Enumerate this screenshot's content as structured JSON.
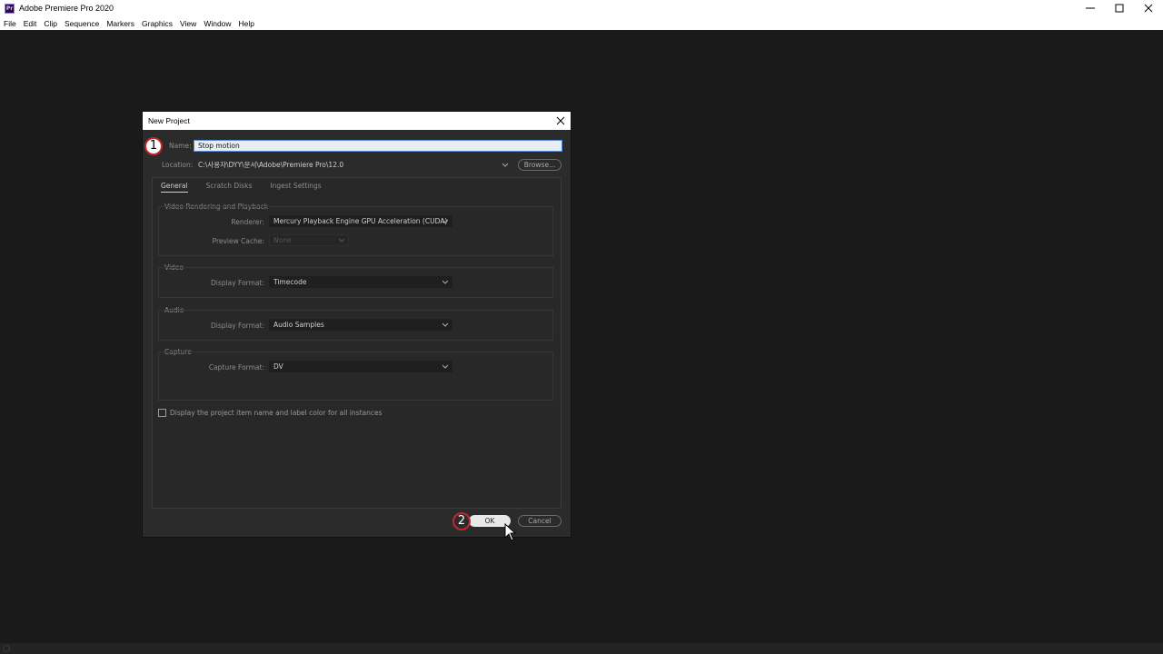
{
  "app": {
    "icon_text": "Pr",
    "title": "Adobe Premiere Pro 2020"
  },
  "menu": [
    "File",
    "Edit",
    "Clip",
    "Sequence",
    "Markers",
    "Graphics",
    "View",
    "Window",
    "Help"
  ],
  "dialog": {
    "title": "New Project",
    "name_label": "Name:",
    "name_value": "Stop motion",
    "location_label": "Location:",
    "location_value": "C:\\사용자\\DYY\\문서\\Adobe\\Premiere Pro\\12.0",
    "browse_label": "Browse...",
    "tabs": [
      {
        "label": "General",
        "active": true
      },
      {
        "label": "Scratch Disks",
        "active": false
      },
      {
        "label": "Ingest Settings",
        "active": false
      }
    ],
    "groups": {
      "video_rendering": {
        "title": "Video Rendering and Playback",
        "renderer_label": "Renderer:",
        "renderer_value": "Mercury Playback Engine GPU Acceleration (CUDA)",
        "preview_cache_label": "Preview Cache:",
        "preview_cache_value": "None"
      },
      "video": {
        "title": "Video",
        "display_format_label": "Display Format:",
        "display_format_value": "Timecode"
      },
      "audio": {
        "title": "Audio",
        "display_format_label": "Display Format:",
        "display_format_value": "Audio Samples"
      },
      "capture": {
        "title": "Capture",
        "capture_format_label": "Capture Format:",
        "capture_format_value": "DV"
      }
    },
    "checkbox_label": "Display the project item name and label color for all instances",
    "ok_label": "OK",
    "cancel_label": "Cancel"
  },
  "annotations": [
    "1",
    "2"
  ],
  "colors": {
    "annotation_ring": "#c0282b",
    "accent_focus": "#5c8fd6"
  }
}
